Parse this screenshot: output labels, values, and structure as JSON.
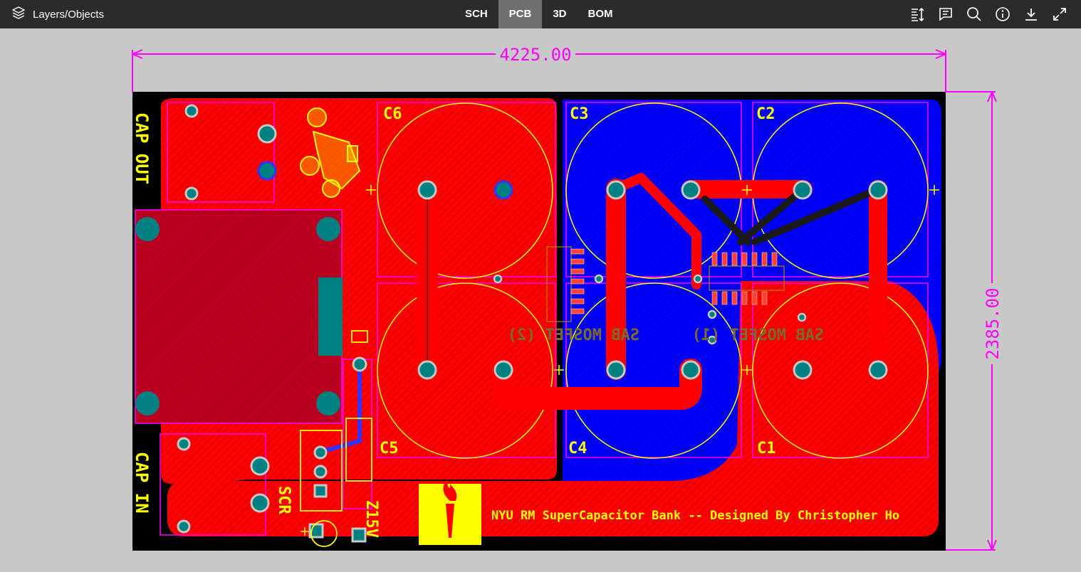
{
  "toolbar": {
    "layers_label": "Layers/Objects",
    "tabs": [
      {
        "label": "SCH",
        "active": false
      },
      {
        "label": "PCB",
        "active": true
      },
      {
        "label": "3D",
        "active": false
      },
      {
        "label": "BOM",
        "active": false
      }
    ],
    "tools": [
      "height-sort-icon",
      "comment-icon",
      "search-icon",
      "info-icon",
      "download-icon",
      "fullscreen-icon"
    ]
  },
  "pcb": {
    "dim_width": "4225.00",
    "dim_height": "2385.00",
    "labels": {
      "cap_out": "CAP OUT",
      "cap_in": "CAP IN",
      "c1": "C1",
      "c2": "C2",
      "c3": "C3",
      "c4": "C4",
      "c5": "C5",
      "c6": "C6",
      "mosfet1": "SAB MOSFET (1)",
      "mosfet2": "SAB MOSFET (2)",
      "scr": "SCR",
      "zener": "Z15V",
      "credit": "NYU RM SuperCapacitor Bank -- Designed By Christopher Ho"
    },
    "colors": {
      "board": "#000000",
      "top_copper": "#ff0000",
      "bottom_copper": "#0000ff",
      "silkscreen": "#ffff00",
      "dimension": "#ff00ff",
      "pad": "#008080",
      "background": "#c8c8c8"
    }
  }
}
